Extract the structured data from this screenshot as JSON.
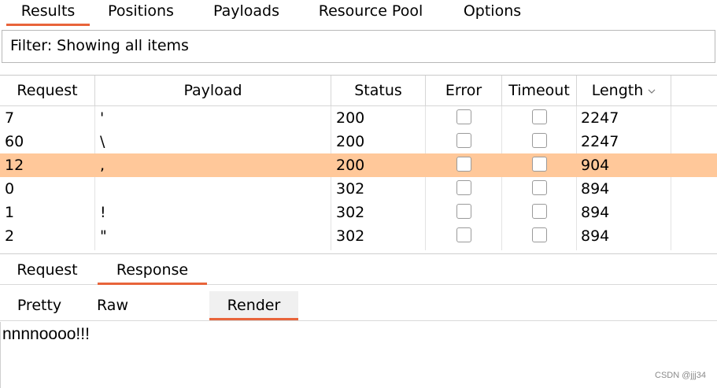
{
  "top_tabs": [
    "Results",
    "Positions",
    "Payloads",
    "Resource Pool",
    "Options"
  ],
  "filter": {
    "text": "Filter: Showing all items"
  },
  "table": {
    "columns": [
      "Request",
      "Payload",
      "Status",
      "Error",
      "Timeout",
      "Length"
    ],
    "rows": [
      {
        "request": "7",
        "payload": "'",
        "status": "200",
        "length": "2247",
        "selected": false
      },
      {
        "request": "60",
        "payload": "\\",
        "status": "200",
        "length": "2247",
        "selected": false
      },
      {
        "request": "12",
        "payload": ",",
        "status": "200",
        "length": "904",
        "selected": true
      },
      {
        "request": "0",
        "payload": "",
        "status": "302",
        "length": "894",
        "selected": false
      },
      {
        "request": "1",
        "payload": "!",
        "status": "302",
        "length": "894",
        "selected": false
      },
      {
        "request": "2",
        "payload": "\"",
        "status": "302",
        "length": "894",
        "selected": false
      }
    ]
  },
  "rr_tabs": [
    "Request",
    "Response"
  ],
  "view_tabs": [
    "Pretty",
    "Raw",
    "Render"
  ],
  "render": {
    "text": "nnnnoooo!!!"
  },
  "watermark": "CSDN @jjj34",
  "colors": {
    "accent": "#e8643a",
    "selected_row": "#ffc89a"
  }
}
